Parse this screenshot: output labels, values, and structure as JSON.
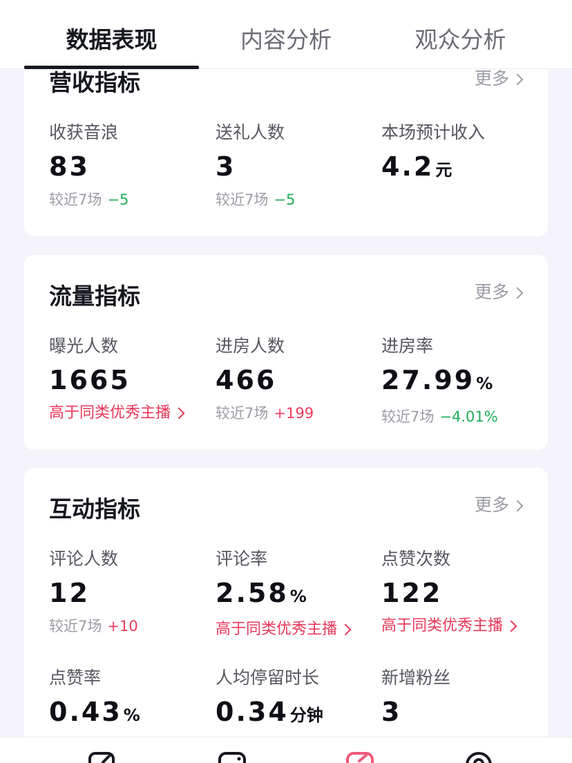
{
  "tabs": [
    "数据表现",
    "内容分析",
    "观众分析"
  ],
  "more_label": "更多",
  "revenue": {
    "title": "营收指标",
    "metrics": [
      {
        "label": "收获音浪",
        "value": "83",
        "compare_label": "较近7场",
        "delta": "−5"
      },
      {
        "label": "送礼人数",
        "value": "3",
        "compare_label": "较近7场",
        "delta": "−5"
      },
      {
        "label": "本场预计收入",
        "value": "4.2",
        "unit": "元"
      }
    ]
  },
  "traffic": {
    "title": "流量指标",
    "metrics": [
      {
        "label": "曝光人数",
        "value": "1665",
        "link": "高于同类优秀主播"
      },
      {
        "label": "进房人数",
        "value": "466",
        "compare_label": "较近7场",
        "delta": "+199"
      },
      {
        "label": "进房率",
        "value": "27.99",
        "unit": "%",
        "compare_label": "较近7场",
        "delta": "−4.01%"
      }
    ]
  },
  "interaction": {
    "title": "互动指标",
    "metrics": [
      {
        "label": "评论人数",
        "value": "12",
        "compare_label": "较近7场",
        "delta": "+10"
      },
      {
        "label": "评论率",
        "value": "2.58",
        "unit": "%",
        "link": "高于同类优秀主播"
      },
      {
        "label": "点赞次数",
        "value": "122",
        "link": "高于同类优秀主播"
      },
      {
        "label": "点赞率",
        "value": "0.43",
        "unit": "%"
      },
      {
        "label": "人均停留时长",
        "value": "0.34",
        "unit": "分钟"
      },
      {
        "label": "新增粉丝",
        "value": "3"
      }
    ]
  },
  "colors": {
    "accent_red": "#e8385a",
    "positive_red": "#f03c5c",
    "negative_green": "#1fae5b",
    "page_bg": "#f4f4fa"
  },
  "bottom_nav_icons": [
    "edit-icon",
    "chat-icon",
    "pink-tag-icon",
    "location-icon"
  ]
}
